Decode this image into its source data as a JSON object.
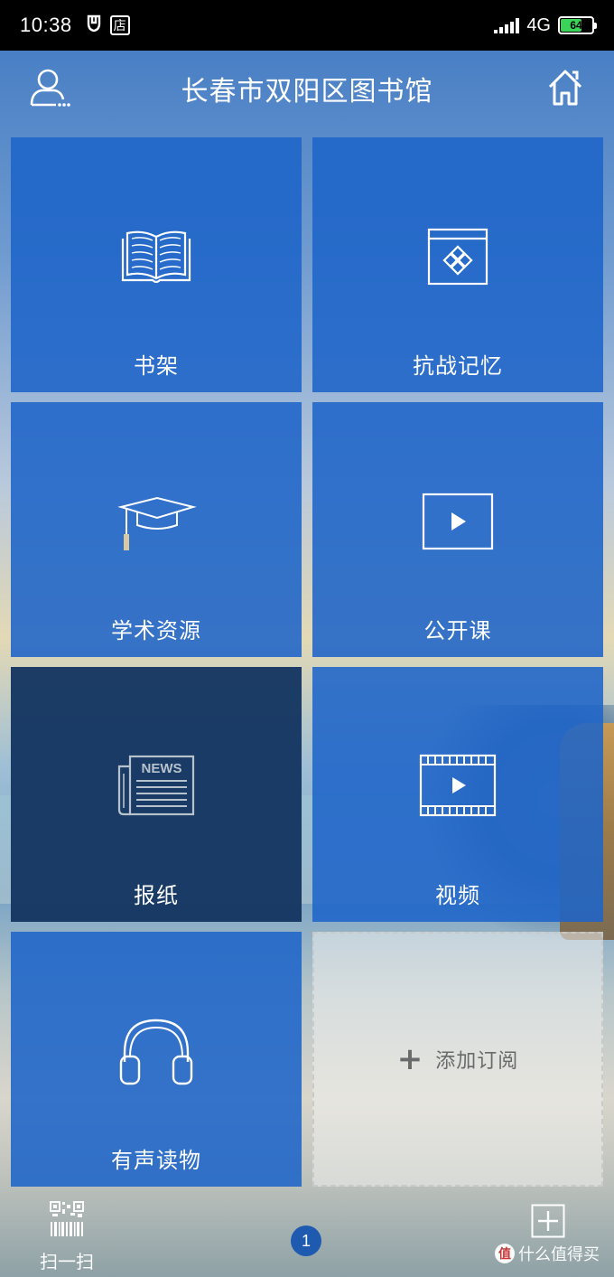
{
  "status_bar": {
    "time": "10:38",
    "badge_text": "店",
    "network": "4G",
    "battery": "64",
    "battery_level": 0.64
  },
  "header": {
    "title": "长春市双阳区图书馆",
    "user_icon": "user-icon",
    "home_icon": "home-icon"
  },
  "tiles": [
    {
      "label": "书架",
      "icon": "book-icon"
    },
    {
      "label": "抗战记忆",
      "icon": "window-diamond-icon"
    },
    {
      "label": "学术资源",
      "icon": "graduation-cap-icon"
    },
    {
      "label": "公开课",
      "icon": "play-box-icon"
    },
    {
      "label": "报纸",
      "icon": "newspaper-icon",
      "icon_text": "NEWS"
    },
    {
      "label": "视频",
      "icon": "film-play-icon"
    },
    {
      "label": "有声读物",
      "icon": "headphones-icon"
    }
  ],
  "add_tile": {
    "plus": "+",
    "label": "添加订阅"
  },
  "bottom": {
    "scan_label": "扫一扫",
    "page_number": "1"
  },
  "watermark": {
    "logo": "值",
    "text": "什么值得买"
  },
  "colors": {
    "tile_blue": "#1e64c8",
    "tile_dark": "#123460",
    "status_bar": "#000000",
    "page_dot": "#1e5bb0"
  }
}
